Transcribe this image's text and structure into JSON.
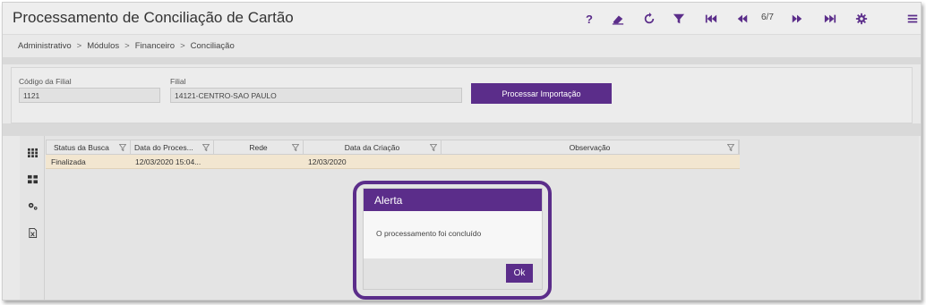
{
  "header": {
    "title": "Processamento de Conciliação de Cartão",
    "help_label": "?",
    "page_counter": "6/7"
  },
  "breadcrumb": [
    "Administrativo",
    "Módulos",
    "Financeiro",
    "Conciliação"
  ],
  "breadcrumb_separator": ">",
  "filters": {
    "branch_code_label": "Código da Filial",
    "branch_code_value": "1121",
    "branch_label": "Filial",
    "branch_value": "14121-CENTRO-SAO PAULO",
    "process_button": "Processar Importação"
  },
  "grid": {
    "columns": [
      "Status da Busca",
      "Data do Proces...",
      "Rede",
      "Data da Criação",
      "Observação"
    ],
    "rows": [
      [
        "Finalizada",
        "12/03/2020 15:04...",
        "",
        "12/03/2020",
        ""
      ]
    ]
  },
  "modal": {
    "title": "Alerta",
    "message": "O processamento foi concluído",
    "ok_button": "Ok"
  },
  "colors": {
    "accent": "#5b2d8a",
    "row_highlight": "#f2e6d0"
  },
  "icons": {
    "toolbar": [
      "help-icon",
      "eraser-icon",
      "refresh-icon",
      "filter-icon",
      "first-page-icon",
      "previous-page-icon",
      "next-page-icon",
      "last-page-icon",
      "settings-icon",
      "menu-icon"
    ],
    "sidebar": [
      "grid-view-icon",
      "tiles-view-icon",
      "settings-gears-icon",
      "export-excel-icon"
    ]
  }
}
